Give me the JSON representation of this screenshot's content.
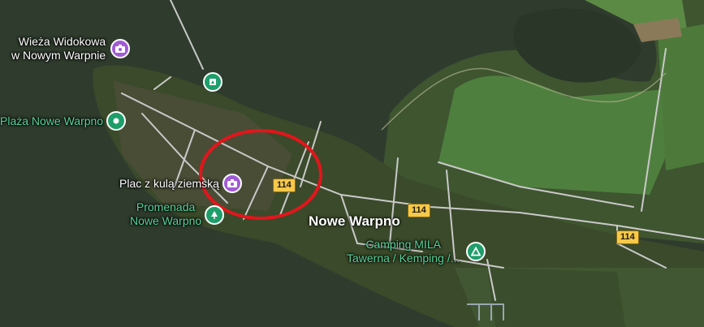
{
  "map": {
    "town": "Nowe Warpno",
    "road_number": "114",
    "colors": {
      "water": "#2f3c2d",
      "land_dark": "#3b4a2a",
      "fields": "#4f7f3e",
      "roads": "#c9c9c9",
      "highlight": "#e4151b",
      "poi_purple": "#a05bd6",
      "poi_green": "#1e9e6a",
      "label_green": "#58d39a"
    },
    "pois": [
      {
        "label_lines": [
          "Wieża Widokowa",
          "w Nowym Warpnie"
        ],
        "icon": "camera-icon",
        "kind": "purple"
      },
      {
        "label_lines": [],
        "icon": "map-pin-icon",
        "kind": "green"
      },
      {
        "label_lines": [
          "Plaża Nowe Warpno"
        ],
        "icon": "beach-icon",
        "kind": "green"
      },
      {
        "label_lines": [
          "Plac z kulą ziemską"
        ],
        "icon": "camera-icon",
        "kind": "purple"
      },
      {
        "label_lines": [
          "Promenada",
          "Nowe Warpno"
        ],
        "icon": "park-icon",
        "kind": "green"
      },
      {
        "label_lines": [
          "Camping MILA",
          "Tawerna / Kemping /..."
        ],
        "icon": "campground-icon",
        "kind": "green"
      }
    ]
  }
}
